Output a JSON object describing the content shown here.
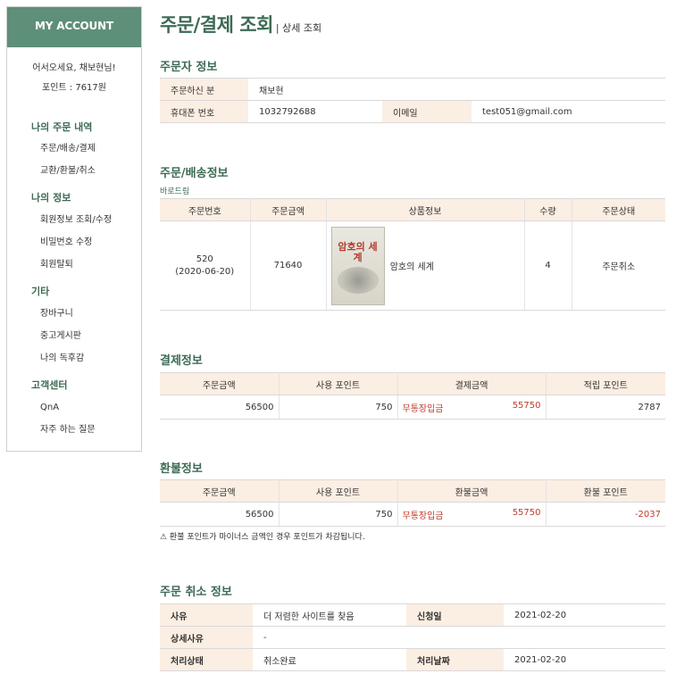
{
  "sidebar": {
    "header": "MY ACCOUNT",
    "welcome": "어서오세요, 채보현님!",
    "points": "포인트 : 7617원",
    "groups": [
      {
        "title": "나의 주문 내역",
        "items": [
          "주문/배송/결제",
          "교환/환불/취소"
        ]
      },
      {
        "title": "나의 정보",
        "items": [
          "회원정보 조회/수정",
          "비밀번호 수정",
          "회원탈퇴"
        ]
      },
      {
        "title": "기타",
        "items": [
          "장바구니",
          "중고게시판",
          "나의 독후감"
        ]
      },
      {
        "title": "고객센터",
        "items": [
          "QnA",
          "자주 하는 질문"
        ]
      }
    ]
  },
  "page": {
    "title": "주문/결제 조회",
    "subtitle": "| 상세 조회"
  },
  "orderer": {
    "section_title": "주문자 정보",
    "name_label": "주문하신 분",
    "name": "채보현",
    "phone_label": "휴대폰 번호",
    "phone": "1032792688",
    "email_label": "이메일",
    "email": "test051@gmail.com"
  },
  "delivery": {
    "section_title": "주문/배송정보",
    "shop": "바로드림",
    "headers": [
      "주문번호",
      "주문금액",
      "상품정보",
      "수량",
      "주문상태"
    ],
    "order_no": "520",
    "order_date": "(2020-06-20)",
    "amount": "71640",
    "book_cover_title": "암호의 세계",
    "product": "암호의 세계",
    "qty": "4",
    "status": "주문취소"
  },
  "payment": {
    "section_title": "결제정보",
    "headers": [
      "주문금액",
      "사용 포인트",
      "결제금액",
      "적립 포인트"
    ],
    "order_amount": "56500",
    "used_points": "750",
    "method": "무통장입금",
    "paid": "55750",
    "earned": "2787"
  },
  "refund": {
    "section_title": "환불정보",
    "headers": [
      "주문금액",
      "사용 포인트",
      "환불금액",
      "환불 포인트"
    ],
    "order_amount": "56500",
    "used_points": "750",
    "method": "무통장입금",
    "refund_amount": "55750",
    "refund_points": "-2037",
    "note": "⚠ 환불 포인트가 마이너스 금액인 경우 포인트가 차감됩니다."
  },
  "cancel": {
    "section_title": "주문 취소 정보",
    "reason_label": "사유",
    "reason": "더 저렴한 사이트를 찾음",
    "request_label": "신청일",
    "request_date": "2021-02-20",
    "detail_label": "상세사유",
    "detail": "-",
    "state_label": "처리상태",
    "state": "취소완료",
    "process_label": "처리날짜",
    "process_date": "2021-02-20"
  },
  "colors": {
    "brand": "#5e8f78",
    "title": "#3d6b55",
    "header_bg": "#fbeee3",
    "red": "#c0392b"
  }
}
